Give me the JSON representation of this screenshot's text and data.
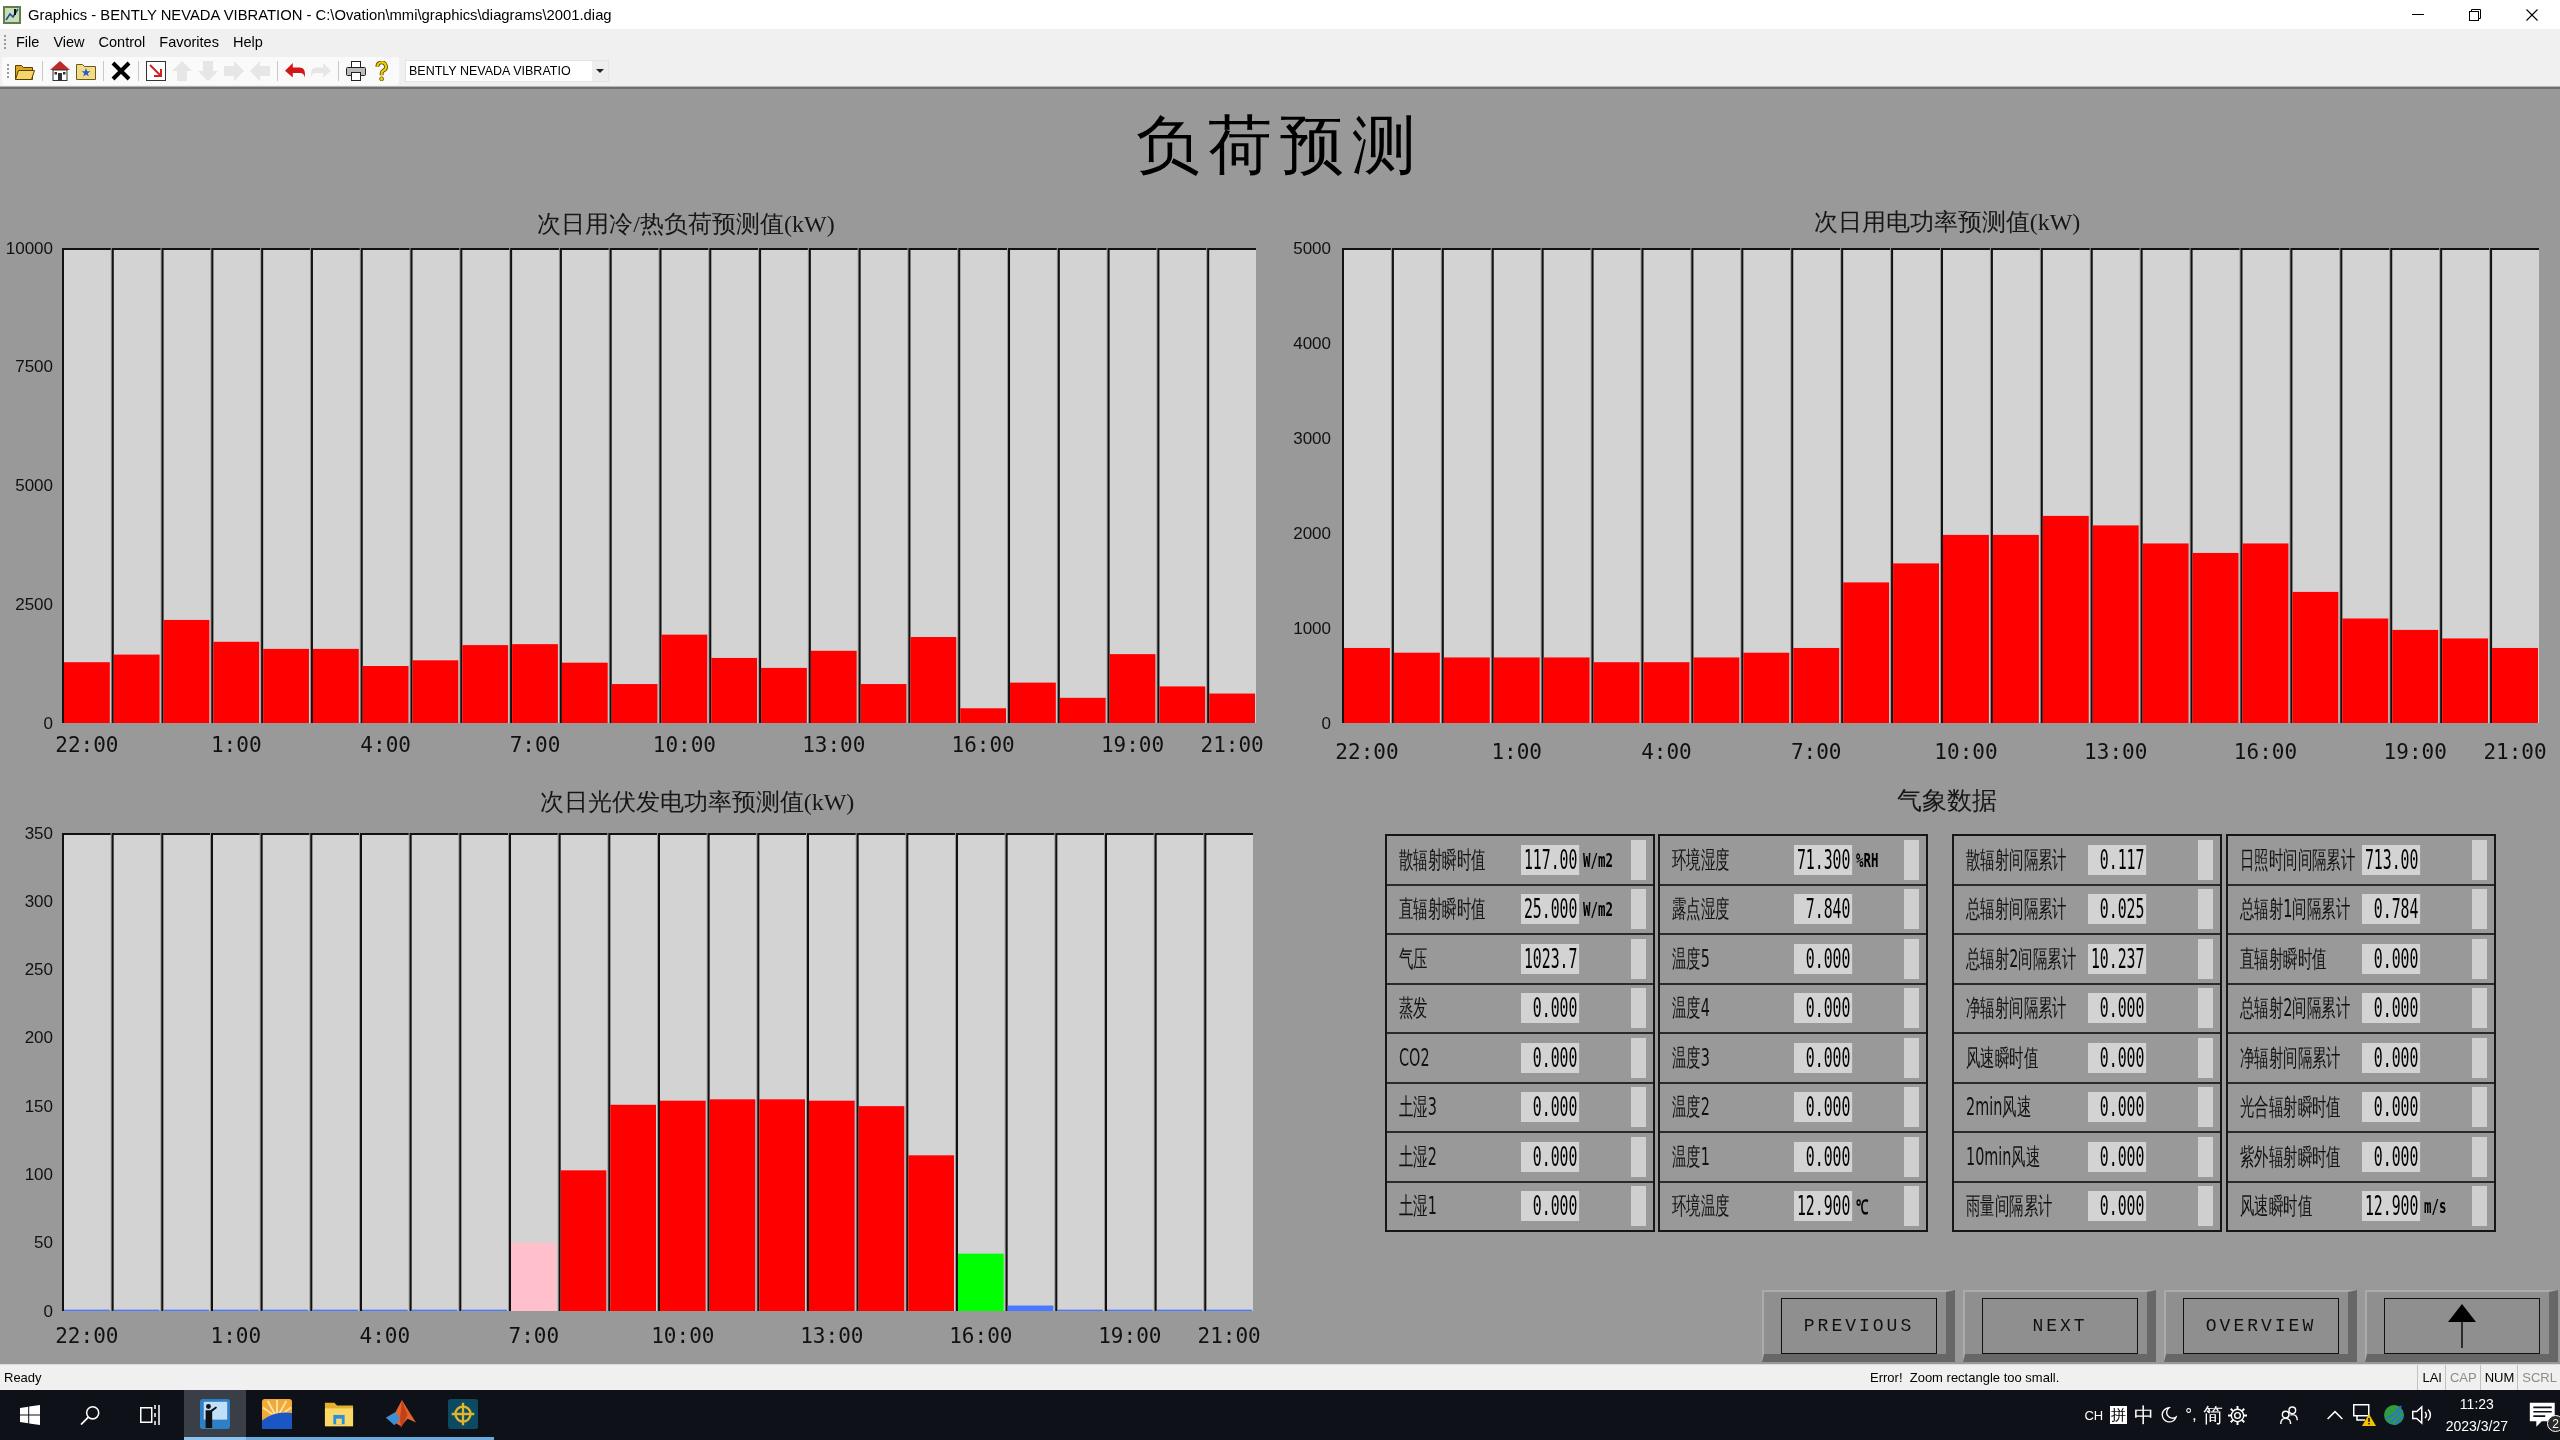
{
  "window": {
    "title": "Graphics - BENTLY NEVADA VIBRATION - C:\\Ovation\\mmi\\graphics\\diagrams\\2001.diag"
  },
  "menu": [
    "File",
    "View",
    "Control",
    "Favorites",
    "Help"
  ],
  "toolbar": {
    "groups": [
      [
        {
          "disabled": false
        }
      ],
      [
        {
          "disabled": false
        },
        {
          "disabled": false
        }
      ],
      [
        {
          "disabled": false
        }
      ],
      [
        {
          "disabled": false
        },
        {
          "disabled": true
        },
        {
          "disabled": true
        },
        {
          "disabled": true
        },
        {
          "disabled": true
        }
      ],
      [
        {
          "disabled": false
        },
        {
          "disabled": true
        }
      ],
      [
        {
          "disabled": false
        },
        {
          "disabled": false
        }
      ]
    ],
    "dropdown": {
      "value": "BENTLY NEVADA VIBRATIO"
    }
  },
  "page_title": "负荷预测",
  "charts": [
    {
      "chart_data": {
        "type": "bar",
        "title": "次日用冷/热负荷预测值(kW)",
        "ylim": [
          0,
          10000
        ],
        "yticks": [
          0,
          2500,
          5000,
          7500,
          10000
        ],
        "categories": [
          "22:00",
          null,
          null,
          "1:00",
          null,
          null,
          "4:00",
          null,
          null,
          "7:00",
          null,
          null,
          "10:00",
          null,
          null,
          "13:00",
          null,
          null,
          "16:00",
          null,
          null,
          "19:00",
          null,
          "21:00"
        ],
        "series": [
          {
            "color": "#ff0000",
            "values": [
              1280,
              1440,
              2170,
              1710,
              1560,
              1560,
              1200,
              1320,
              1640,
              1660,
              1270,
              820,
              1860,
              1370,
              1160,
              1520,
              820,
              1810,
              310,
              850,
              530,
              1450,
              770,
              620
            ]
          }
        ]
      }
    },
    {
      "chart_data": {
        "type": "bar",
        "title": "次日用电功率预测值(kW)",
        "ylim": [
          0,
          5000
        ],
        "yticks": [
          0,
          1000,
          2000,
          3000,
          4000,
          5000
        ],
        "categories": [
          "22:00",
          null,
          null,
          "1:00",
          null,
          null,
          "4:00",
          null,
          null,
          "7:00",
          null,
          null,
          "10:00",
          null,
          null,
          "13:00",
          null,
          null,
          "16:00",
          null,
          null,
          "19:00",
          null,
          "21:00"
        ],
        "series": [
          {
            "color": "#ff0000",
            "values": [
              790,
              740,
              690,
              690,
              690,
              640,
              640,
              690,
              740,
              790,
              1480,
              1680,
              1980,
              1980,
              2180,
              2080,
              1890,
              1790,
              1890,
              1380,
              1100,
              980,
              890,
              790
            ]
          }
        ]
      }
    },
    {
      "chart_data": {
        "type": "bar",
        "title": "次日光伏发电功率预测值(kW)",
        "ylim": [
          0,
          350
        ],
        "yticks": [
          0,
          50,
          100,
          150,
          200,
          250,
          300,
          350
        ],
        "categories": [
          "22:00",
          null,
          null,
          "1:00",
          null,
          null,
          "4:00",
          null,
          null,
          "7:00",
          null,
          null,
          "10:00",
          null,
          null,
          "13:00",
          null,
          null,
          "16:00",
          null,
          null,
          "19:00",
          null,
          "21:00"
        ],
        "series": [
          {
            "color": "#ff0000",
            "values": [
              null,
              null,
              null,
              null,
              null,
              null,
              null,
              null,
              null,
              null,
              103,
              151,
              154,
              155,
              155,
              154,
              150,
              114,
              null,
              null,
              null,
              null,
              null,
              null
            ]
          },
          {
            "color": "#ffc0cb",
            "values": [
              null,
              null,
              null,
              null,
              null,
              null,
              null,
              null,
              null,
              50,
              null,
              null,
              null,
              null,
              null,
              null,
              null,
              null,
              null,
              null,
              null,
              null,
              null,
              null
            ]
          },
          {
            "color": "#00ff00",
            "values": [
              null,
              null,
              null,
              null,
              null,
              null,
              null,
              null,
              null,
              null,
              null,
              null,
              null,
              null,
              null,
              null,
              null,
              null,
              42,
              null,
              null,
              null,
              null,
              null
            ]
          },
          {
            "color": "#4a78ff",
            "values": [
              1,
              1,
              1,
              1,
              1,
              1,
              1,
              1,
              1,
              null,
              null,
              null,
              null,
              null,
              null,
              null,
              null,
              null,
              null,
              4,
              1,
              1,
              1,
              1
            ]
          }
        ]
      }
    }
  ],
  "weather": {
    "title": "气象数据",
    "panels": [
      {
        "rows": [
          {
            "label": "散辐射瞬时值",
            "value": "117.00",
            "unit": "W/m2"
          },
          {
            "label": "直辐射瞬时值",
            "value": "25.000",
            "unit": "W/m2"
          },
          {
            "label": "气压",
            "value": "1023.7"
          },
          {
            "label": "蒸发",
            "value": "0.000"
          },
          {
            "label": "CO2",
            "value": "0.000"
          },
          {
            "label": "土湿3",
            "value": "0.000"
          },
          {
            "label": "土湿2",
            "value": "0.000"
          },
          {
            "label": "土湿1",
            "value": "0.000"
          }
        ]
      },
      {
        "rows": [
          {
            "label": "环境湿度",
            "value": "71.300",
            "unit": "%RH"
          },
          {
            "label": "露点湿度",
            "value": "7.840"
          },
          {
            "label": "温度5",
            "value": "0.000"
          },
          {
            "label": "温度4",
            "value": "0.000"
          },
          {
            "label": "温度3",
            "value": "0.000"
          },
          {
            "label": "温度2",
            "value": "0.000"
          },
          {
            "label": "温度1",
            "value": "0.000"
          },
          {
            "label": "环境温度",
            "value": "12.900",
            "unit": "℃"
          }
        ]
      },
      {
        "rows": [
          {
            "label": "散辐射间隔累计",
            "value": "0.117"
          },
          {
            "label": "总辐射间隔累计",
            "value": "0.025"
          },
          {
            "label": "总辐射2间隔累计",
            "value": "10.237"
          },
          {
            "label": "净辐射间隔累计",
            "value": "0.000"
          },
          {
            "label": "风速瞬时值",
            "value": "0.000"
          },
          {
            "label": "2min风速",
            "value": "0.000"
          },
          {
            "label": "10min风速",
            "value": "0.000"
          },
          {
            "label": "雨量间隔累计",
            "value": "0.000"
          }
        ]
      },
      {
        "rows": [
          {
            "label": "日照时间间隔累计",
            "value": "713.00"
          },
          {
            "label": "总辐射1间隔累计",
            "value": "0.784"
          },
          {
            "label": "直辐射瞬时值",
            "value": "0.000"
          },
          {
            "label": "总辐射2间隔累计",
            "value": "0.000"
          },
          {
            "label": "净辐射间隔累计",
            "value": "0.000"
          },
          {
            "label": "光合辐射瞬时值",
            "value": "0.000"
          },
          {
            "label": "紫外辐射瞬时值",
            "value": "0.000"
          },
          {
            "label": "风速瞬时值",
            "value": "12.900",
            "unit": "m/s"
          }
        ]
      }
    ]
  },
  "buttons": [
    {
      "kind": "text",
      "label": "PREVIOUS"
    },
    {
      "kind": "text",
      "label": "NEXT"
    },
    {
      "kind": "text",
      "label": "OVERVIEW"
    },
    {
      "kind": "icon"
    }
  ],
  "status_bar": {
    "message": "Ready",
    "error": "Error!  Zoom rectangle too small.",
    "indicators": [
      {
        "label": "LAI",
        "on": true
      },
      {
        "label": "CAP",
        "on": false
      },
      {
        "label": "NUM",
        "on": true
      },
      {
        "label": "SCRL",
        "on": false
      }
    ]
  },
  "taskbar": {
    "apps": [
      {
        "selected": true
      },
      {
        "selected": false
      },
      {
        "selected": false
      },
      {
        "selected": false
      },
      {
        "selected": false
      }
    ],
    "language": "CH",
    "ime": "拼",
    "input_mode": "中",
    "punctuation": "°,",
    "charset": "简",
    "time": "11:23",
    "date": "2023/3/27",
    "notification_count": "2"
  }
}
